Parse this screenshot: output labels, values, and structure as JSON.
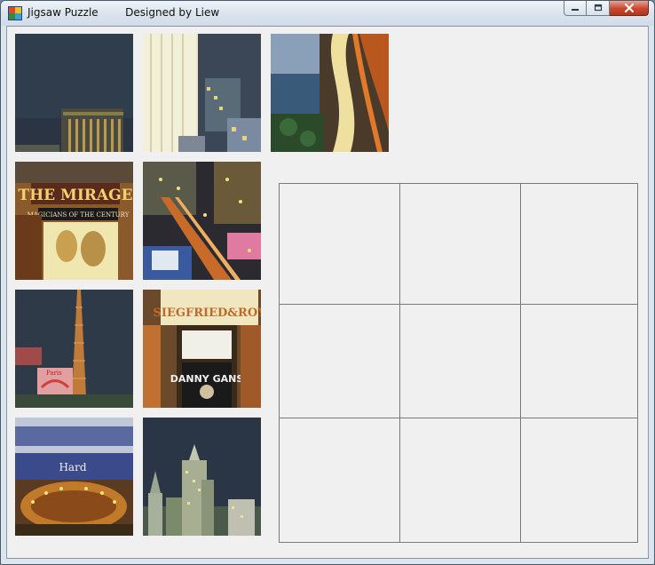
{
  "window": {
    "title": "Jigsaw Puzzle        Designed by Liew",
    "controls": {
      "minimize": "minimize",
      "maximize": "maximize",
      "close": "close"
    }
  },
  "pieces": [
    {
      "id": 1,
      "subject": "dark-sky-hotel-tower"
    },
    {
      "id": 2,
      "subject": "white-tower-buildings"
    },
    {
      "id": 3,
      "subject": "night-street-aerial"
    },
    {
      "id": 4,
      "subject": "the-mirage-sign"
    },
    {
      "id": 5,
      "subject": "strip-night-view"
    },
    {
      "id": 6,
      "subject": "eiffel-tower-replica"
    },
    {
      "id": 7,
      "subject": "siegfried-roy-sign"
    },
    {
      "id": 8,
      "subject": "casino-entrance-lights"
    },
    {
      "id": 9,
      "subject": "skyline-towers"
    }
  ],
  "board": {
    "rows": 3,
    "cols": 3
  },
  "colors": {
    "client_bg": "#f0f0f0",
    "grid_line": "#7a7a7a",
    "close_red": "#c8472f"
  }
}
